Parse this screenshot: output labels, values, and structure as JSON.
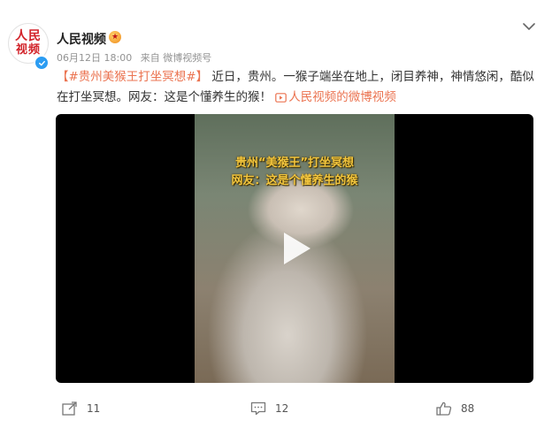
{
  "post": {
    "author": {
      "name": "人民视频",
      "avatar_line1": "人民",
      "avatar_line2": "视频"
    },
    "meta": {
      "date": "06月12日 18:00",
      "source": "来自 微博视频号"
    },
    "content": {
      "hashtag": "【#贵州美猴王打坐冥想#】",
      "text": "近日，贵州。一猴子端坐在地上，闭目养神，神情悠闲，酷似在打坐冥想。网友：这是个懂养生的猴！",
      "video_link": "人民视频的微博视频"
    },
    "video": {
      "overlay_line1": "贵州“美猴王”打坐冥想",
      "overlay_line2": "网友：这是个懂养生的猴"
    },
    "actions": {
      "shares": "11",
      "comments": "12",
      "likes": "88"
    }
  },
  "icons": {
    "more": "chevron-down-icon",
    "share": "share-icon",
    "comment": "comment-icon",
    "like": "thumbs-up-icon",
    "verified": "verified-badge-icon",
    "medal": "medal-icon",
    "play": "play-icon",
    "video_link": "video-link-icon"
  },
  "colors": {
    "accent": "#eb7350",
    "verified": "#2b9cf2",
    "brand_red": "#d2232a",
    "overlay_text": "#f2c53d"
  }
}
